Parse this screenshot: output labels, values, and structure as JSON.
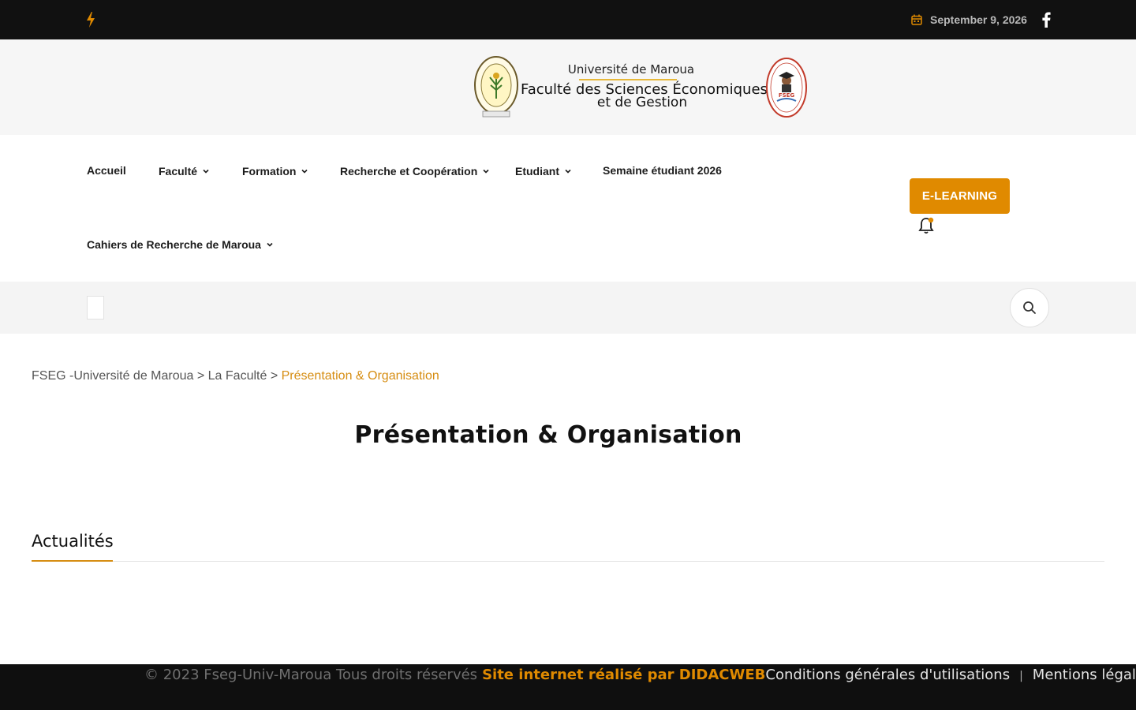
{
  "topbar": {
    "date": "September 9, 2026",
    "icons": {
      "left": "bolt-icon",
      "calendar": "calendar-icon",
      "social": "facebook-icon"
    },
    "colors": {
      "background": "#111111",
      "accent": "#e08a00"
    }
  },
  "header": {
    "university": "Université de Maroua",
    "faculty_line1": "Faculté des Sciences Économiques",
    "faculty_line2": "et de Gestion",
    "seal_right_text": "FSEG"
  },
  "nav": {
    "items": [
      {
        "label": "Accueil",
        "has_dropdown": false
      },
      {
        "label": "Faculté",
        "has_dropdown": true
      },
      {
        "label": "Formation",
        "has_dropdown": true
      },
      {
        "label": "Recherche et Coopération",
        "has_dropdown": true
      },
      {
        "label": "Etudiant",
        "has_dropdown": true
      },
      {
        "label": "Semaine étudiant 2026",
        "has_dropdown": false
      },
      {
        "label": "Cahiers de Recherche de Maroua",
        "has_dropdown": true
      }
    ],
    "cta_label": "E-LEARNING",
    "cta_color": "#e08a00"
  },
  "breadcrumb": {
    "home": "FSEG -Université de Maroua",
    "sep1": ">",
    "parent": "La Faculté",
    "sep2": ">",
    "current": "Présentation & Organisation"
  },
  "main": {
    "title": "Présentation & Organisation",
    "news_heading": "Actualités"
  },
  "footer": {
    "copyright": "© 2023 Fseg-Univ-Maroua Tous droits réservés",
    "credit": "Site internet réalisé par DIDACWEB",
    "terms": "Conditions générales d'utilisations",
    "separator": "|",
    "legal": "Mentions légales"
  }
}
